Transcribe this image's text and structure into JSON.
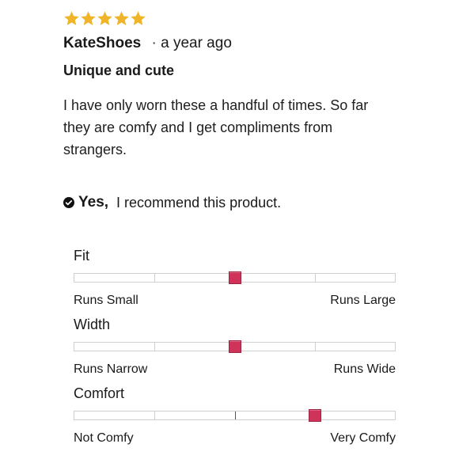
{
  "review": {
    "rating": 5,
    "rating_max": 5,
    "star_color": "#F0B429",
    "author": "KateShoes",
    "separator": "·",
    "time_ago": "a year ago",
    "title": "Unique and cute",
    "body": "I have only worn these a handful of times. So far they are comfy and I get compliments from strangers.",
    "recommend": {
      "icon": "check-circle-icon",
      "answer": "Yes,",
      "text": "I recommend this product."
    }
  },
  "sliders": [
    {
      "label": "Fit",
      "min_label": "Runs Small",
      "max_label": "Runs Large",
      "value": 0.5
    },
    {
      "label": "Width",
      "min_label": "Runs Narrow",
      "max_label": "Runs Wide",
      "value": 0.5
    },
    {
      "label": "Comfort",
      "min_label": "Not Comfy",
      "max_label": "Very Comfy",
      "value": 0.75
    }
  ],
  "slider_accent_color": "#D0335A"
}
